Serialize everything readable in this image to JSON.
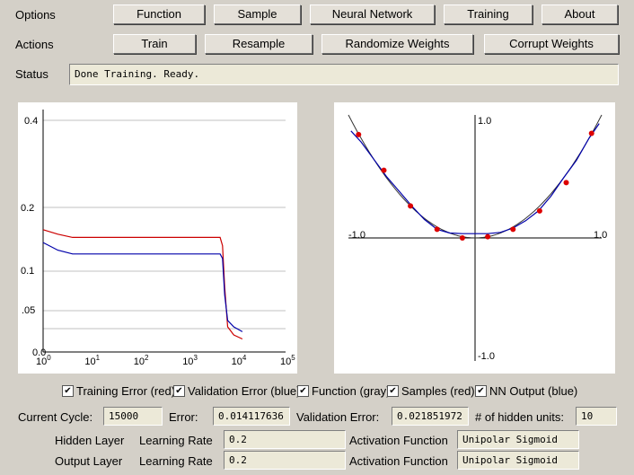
{
  "rows": {
    "options_label": "Options",
    "actions_label": "Actions",
    "status_label": "Status"
  },
  "options": [
    "Function",
    "Sample",
    "Neural Network",
    "Training",
    "About"
  ],
  "actions": [
    "Train",
    "Resample",
    "Randomize Weights",
    "Corrupt Weights"
  ],
  "status_text": "Done Training. Ready.",
  "error_chart": {
    "y_ticks": [
      "0.4",
      "0.2",
      "0.1",
      ".05",
      "0.0"
    ],
    "x_ticks": [
      {
        "base": "10",
        "exp": "0"
      },
      {
        "base": "10",
        "exp": "1"
      },
      {
        "base": "10",
        "exp": "2"
      },
      {
        "base": "10",
        "exp": "3"
      },
      {
        "base": "10",
        "exp": "4"
      },
      {
        "base": "10",
        "exp": "5"
      }
    ]
  },
  "fit_chart": {
    "top_label": "1.0",
    "bottom_label": "-1.0",
    "left_label": "-1.0",
    "right_label": "1.0"
  },
  "checkboxes": [
    {
      "label": "Training Error (red)",
      "checked": true
    },
    {
      "label": "Validation Error (blue)",
      "checked": true
    },
    {
      "label": "Function (gray)",
      "checked": true
    },
    {
      "label": "Samples (red)",
      "checked": true
    },
    {
      "label": "NN Output (blue)",
      "checked": true
    }
  ],
  "stats": {
    "cycle_label": "Current Cycle:",
    "cycle_value": "15000",
    "error_label": "Error:",
    "error_value": "0.014117636",
    "val_label": "Validation Error:",
    "val_value": "0.021851972",
    "hidden_label": "# of hidden units:",
    "hidden_value": "10"
  },
  "layers": {
    "hidden_label": "Hidden Layer",
    "output_label": "Output Layer",
    "lr_label": "Learning Rate",
    "af_label": "Activation Function",
    "hidden_lr": "0.2",
    "output_lr": "0.2",
    "hidden_af": "Unipolar Sigmoid",
    "output_af": "Unipolar Sigmoid"
  },
  "colors": {
    "training_error": "#cc0000",
    "validation_error": "#0000aa",
    "samples": "#dd0000",
    "nn_output": "#0000aa",
    "function": "#333333"
  },
  "chart_data": [
    {
      "type": "line",
      "x_scale": "log",
      "xlim": [
        1,
        100000
      ],
      "y_ticks": [
        0.0,
        0.05,
        0.1,
        0.2,
        0.4
      ],
      "series": [
        {
          "name": "Training Error (red)",
          "x": [
            1,
            2,
            4,
            10,
            100,
            1000,
            4200,
            4700,
            5200,
            6000,
            8000,
            12000
          ],
          "y": [
            0.165,
            0.158,
            0.153,
            0.153,
            0.153,
            0.153,
            0.153,
            0.14,
            0.08,
            0.03,
            0.02,
            0.015
          ]
        },
        {
          "name": "Validation Error (blue)",
          "x": [
            1,
            2,
            4,
            10,
            100,
            1000,
            4200,
            4700,
            5200,
            6000,
            8000,
            12000
          ],
          "y": [
            0.145,
            0.133,
            0.127,
            0.127,
            0.127,
            0.127,
            0.127,
            0.12,
            0.07,
            0.038,
            0.03,
            0.024
          ]
        }
      ]
    },
    {
      "type": "scatter",
      "xlim": [
        -1,
        1
      ],
      "ylim": [
        -1,
        1
      ],
      "series": [
        {
          "name": "Samples (red)",
          "x": [
            -0.92,
            -0.72,
            -0.51,
            -0.3,
            -0.1,
            0.1,
            0.3,
            0.51,
            0.72,
            0.92
          ],
          "y": [
            0.84,
            0.55,
            0.26,
            0.07,
            0.0,
            0.01,
            0.07,
            0.22,
            0.45,
            0.85
          ]
        },
        {
          "name": "Function (gray)",
          "x": [
            -1.0,
            -0.8,
            -0.6,
            -0.4,
            -0.2,
            0.0,
            0.2,
            0.4,
            0.6,
            0.8,
            1.0
          ],
          "y": [
            1.0,
            0.64,
            0.36,
            0.16,
            0.04,
            0.0,
            0.04,
            0.16,
            0.36,
            0.64,
            1.0
          ]
        },
        {
          "name": "NN Output (blue)",
          "x": [
            -0.98,
            -0.9,
            -0.8,
            -0.7,
            -0.6,
            -0.5,
            -0.4,
            -0.3,
            -0.2,
            -0.1,
            0.0,
            0.1,
            0.2,
            0.3,
            0.4,
            0.5,
            0.6,
            0.7,
            0.8,
            0.9,
            0.98
          ],
          "y": [
            0.87,
            0.78,
            0.64,
            0.5,
            0.38,
            0.26,
            0.15,
            0.07,
            0.04,
            0.035,
            0.035,
            0.035,
            0.045,
            0.08,
            0.14,
            0.22,
            0.34,
            0.49,
            0.63,
            0.81,
            0.93
          ]
        }
      ]
    }
  ]
}
